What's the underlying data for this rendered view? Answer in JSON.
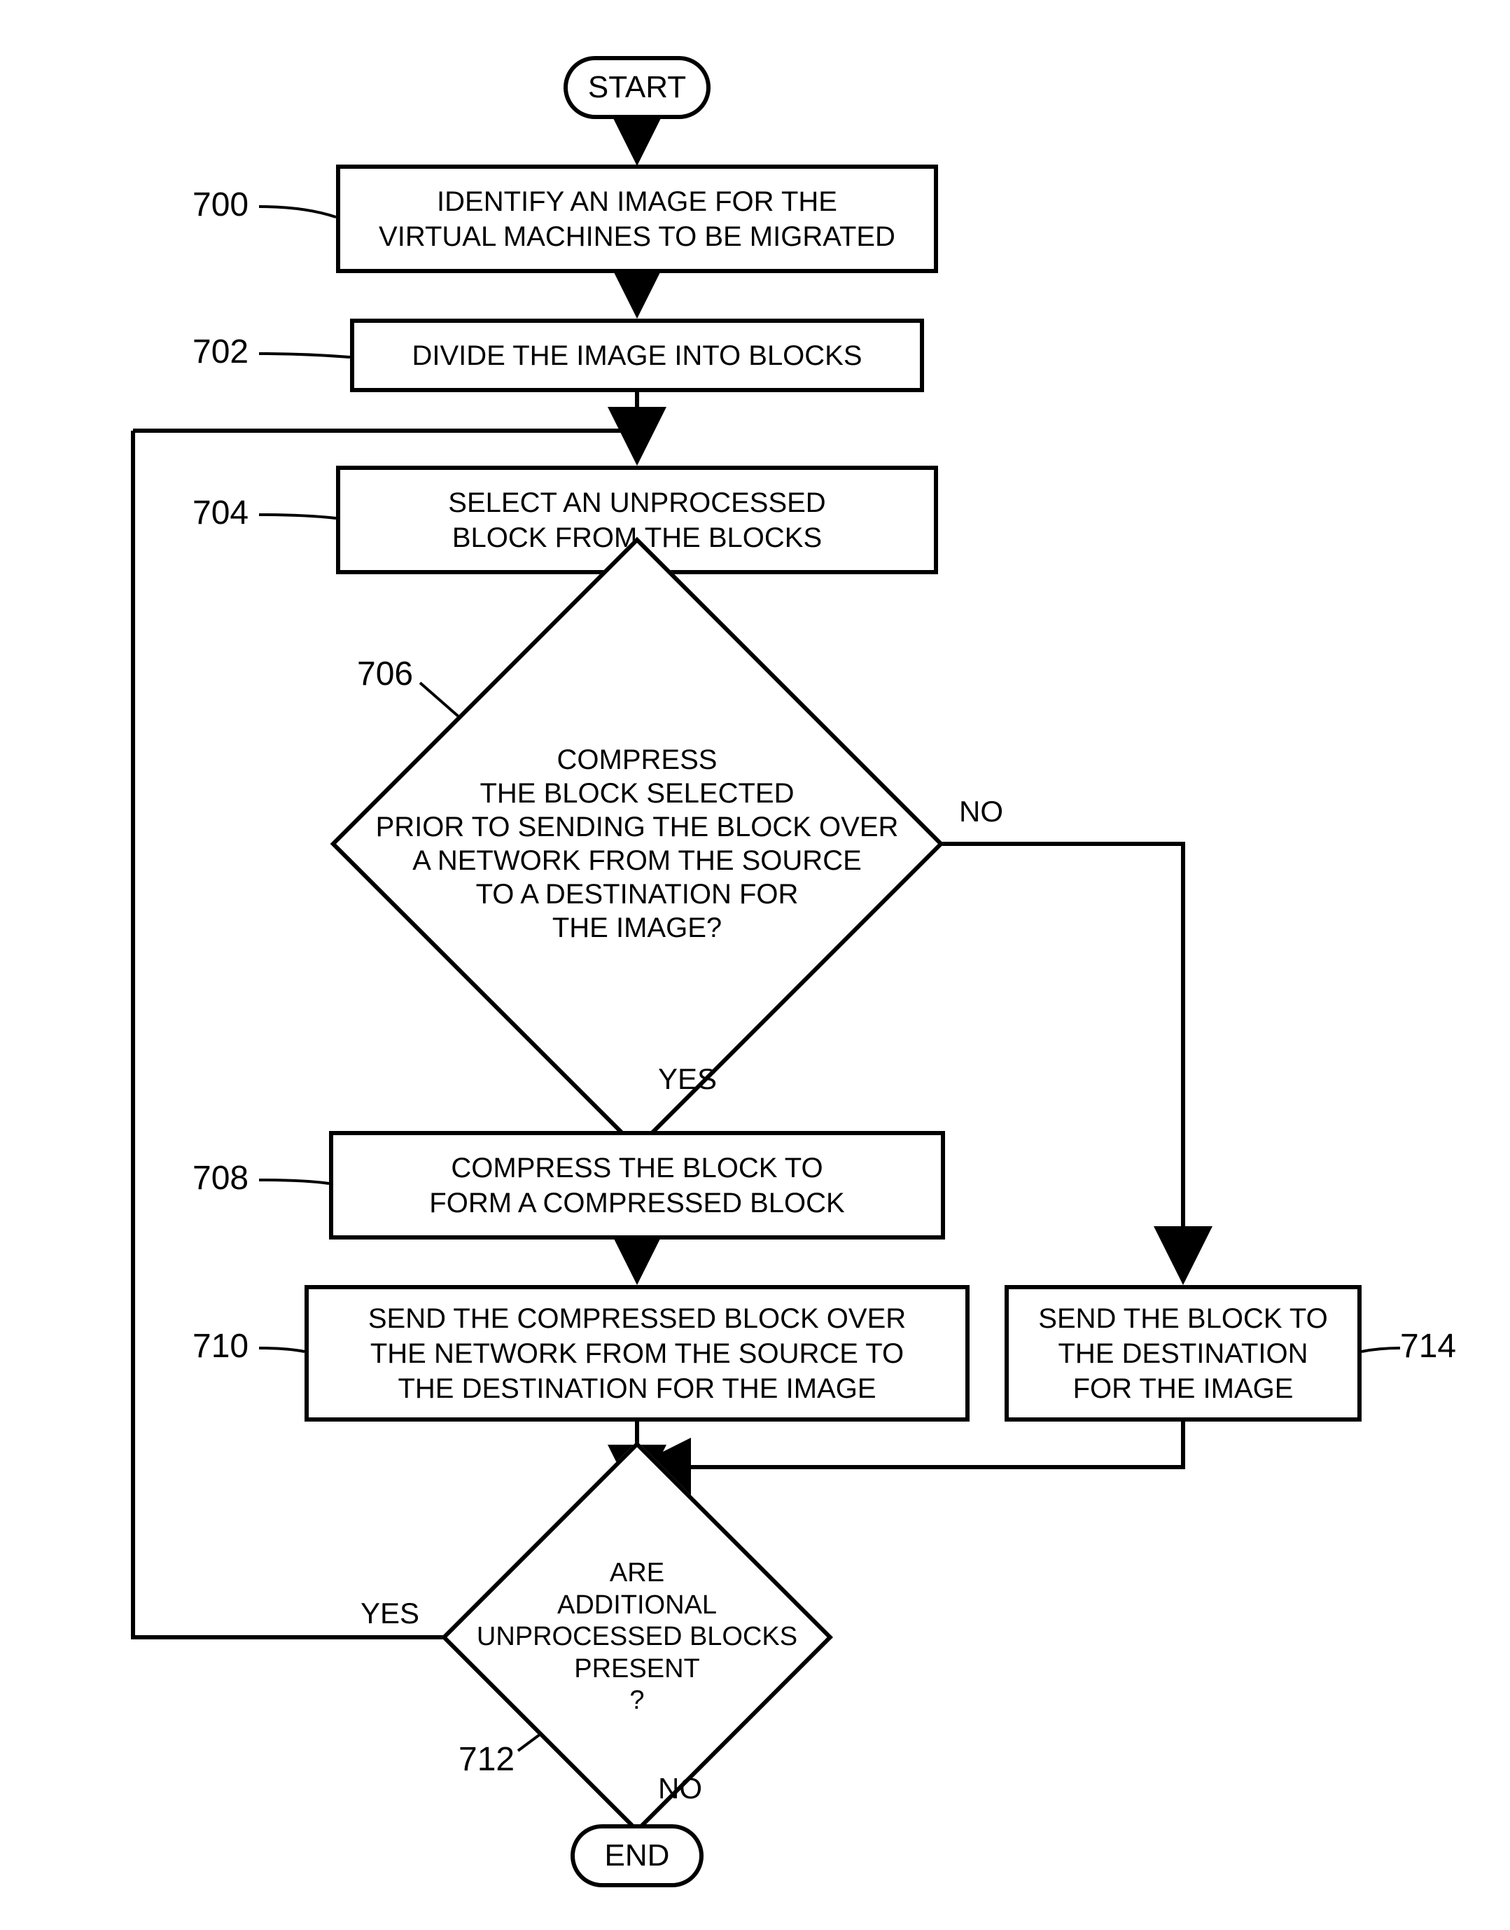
{
  "terminators": {
    "start": "START",
    "end": "END"
  },
  "steps": {
    "s700": "IDENTIFY AN IMAGE FOR THE\nVIRTUAL MACHINES TO BE MIGRATED",
    "s702": "DIVIDE THE IMAGE INTO BLOCKS",
    "s704": "SELECT AN UNPROCESSED\nBLOCK FROM THE BLOCKS",
    "s708": "COMPRESS THE BLOCK TO\nFORM A COMPRESSED BLOCK",
    "s710": "SEND THE COMPRESSED BLOCK OVER\nTHE NETWORK FROM THE SOURCE TO\nTHE DESTINATION FOR THE IMAGE",
    "s714": "SEND THE BLOCK TO\nTHE DESTINATION\nFOR THE IMAGE"
  },
  "decisions": {
    "d706": "COMPRESS\nTHE BLOCK SELECTED\nPRIOR TO SENDING THE BLOCK OVER\nA NETWORK FROM THE SOURCE\nTO A DESTINATION FOR\nTHE IMAGE?",
    "d712": "ARE\nADDITIONAL\nUNPROCESSED BLOCKS\nPRESENT\n?"
  },
  "labels": {
    "yes": "YES",
    "no": "NO"
  },
  "refs": {
    "r700": "700",
    "r702": "702",
    "r704": "704",
    "r706": "706",
    "r708": "708",
    "r710": "710",
    "r712": "712",
    "r714": "714"
  },
  "chart_data": {
    "type": "flowchart",
    "nodes": [
      {
        "id": "start",
        "type": "terminator",
        "label": "START"
      },
      {
        "id": "700",
        "type": "process",
        "label": "IDENTIFY AN IMAGE FOR THE VIRTUAL MACHINES TO BE MIGRATED"
      },
      {
        "id": "702",
        "type": "process",
        "label": "DIVIDE THE IMAGE INTO BLOCKS"
      },
      {
        "id": "704",
        "type": "process",
        "label": "SELECT AN UNPROCESSED BLOCK FROM THE BLOCKS"
      },
      {
        "id": "706",
        "type": "decision",
        "label": "COMPRESS THE BLOCK SELECTED PRIOR TO SENDING THE BLOCK OVER A NETWORK FROM THE SOURCE TO A DESTINATION FOR THE IMAGE?"
      },
      {
        "id": "708",
        "type": "process",
        "label": "COMPRESS THE BLOCK TO FORM A COMPRESSED BLOCK"
      },
      {
        "id": "710",
        "type": "process",
        "label": "SEND THE COMPRESSED BLOCK OVER THE NETWORK FROM THE SOURCE TO THE DESTINATION FOR THE IMAGE"
      },
      {
        "id": "714",
        "type": "process",
        "label": "SEND THE BLOCK TO THE DESTINATION FOR THE IMAGE"
      },
      {
        "id": "712",
        "type": "decision",
        "label": "ARE ADDITIONAL UNPROCESSED BLOCKS PRESENT?"
      },
      {
        "id": "end",
        "type": "terminator",
        "label": "END"
      }
    ],
    "edges": [
      {
        "from": "start",
        "to": "700"
      },
      {
        "from": "700",
        "to": "702"
      },
      {
        "from": "702",
        "to": "704"
      },
      {
        "from": "704",
        "to": "706"
      },
      {
        "from": "706",
        "to": "708",
        "label": "YES"
      },
      {
        "from": "706",
        "to": "714",
        "label": "NO"
      },
      {
        "from": "708",
        "to": "710"
      },
      {
        "from": "710",
        "to": "712"
      },
      {
        "from": "714",
        "to": "712"
      },
      {
        "from": "712",
        "to": "704",
        "label": "YES"
      },
      {
        "from": "712",
        "to": "end",
        "label": "NO"
      }
    ]
  }
}
